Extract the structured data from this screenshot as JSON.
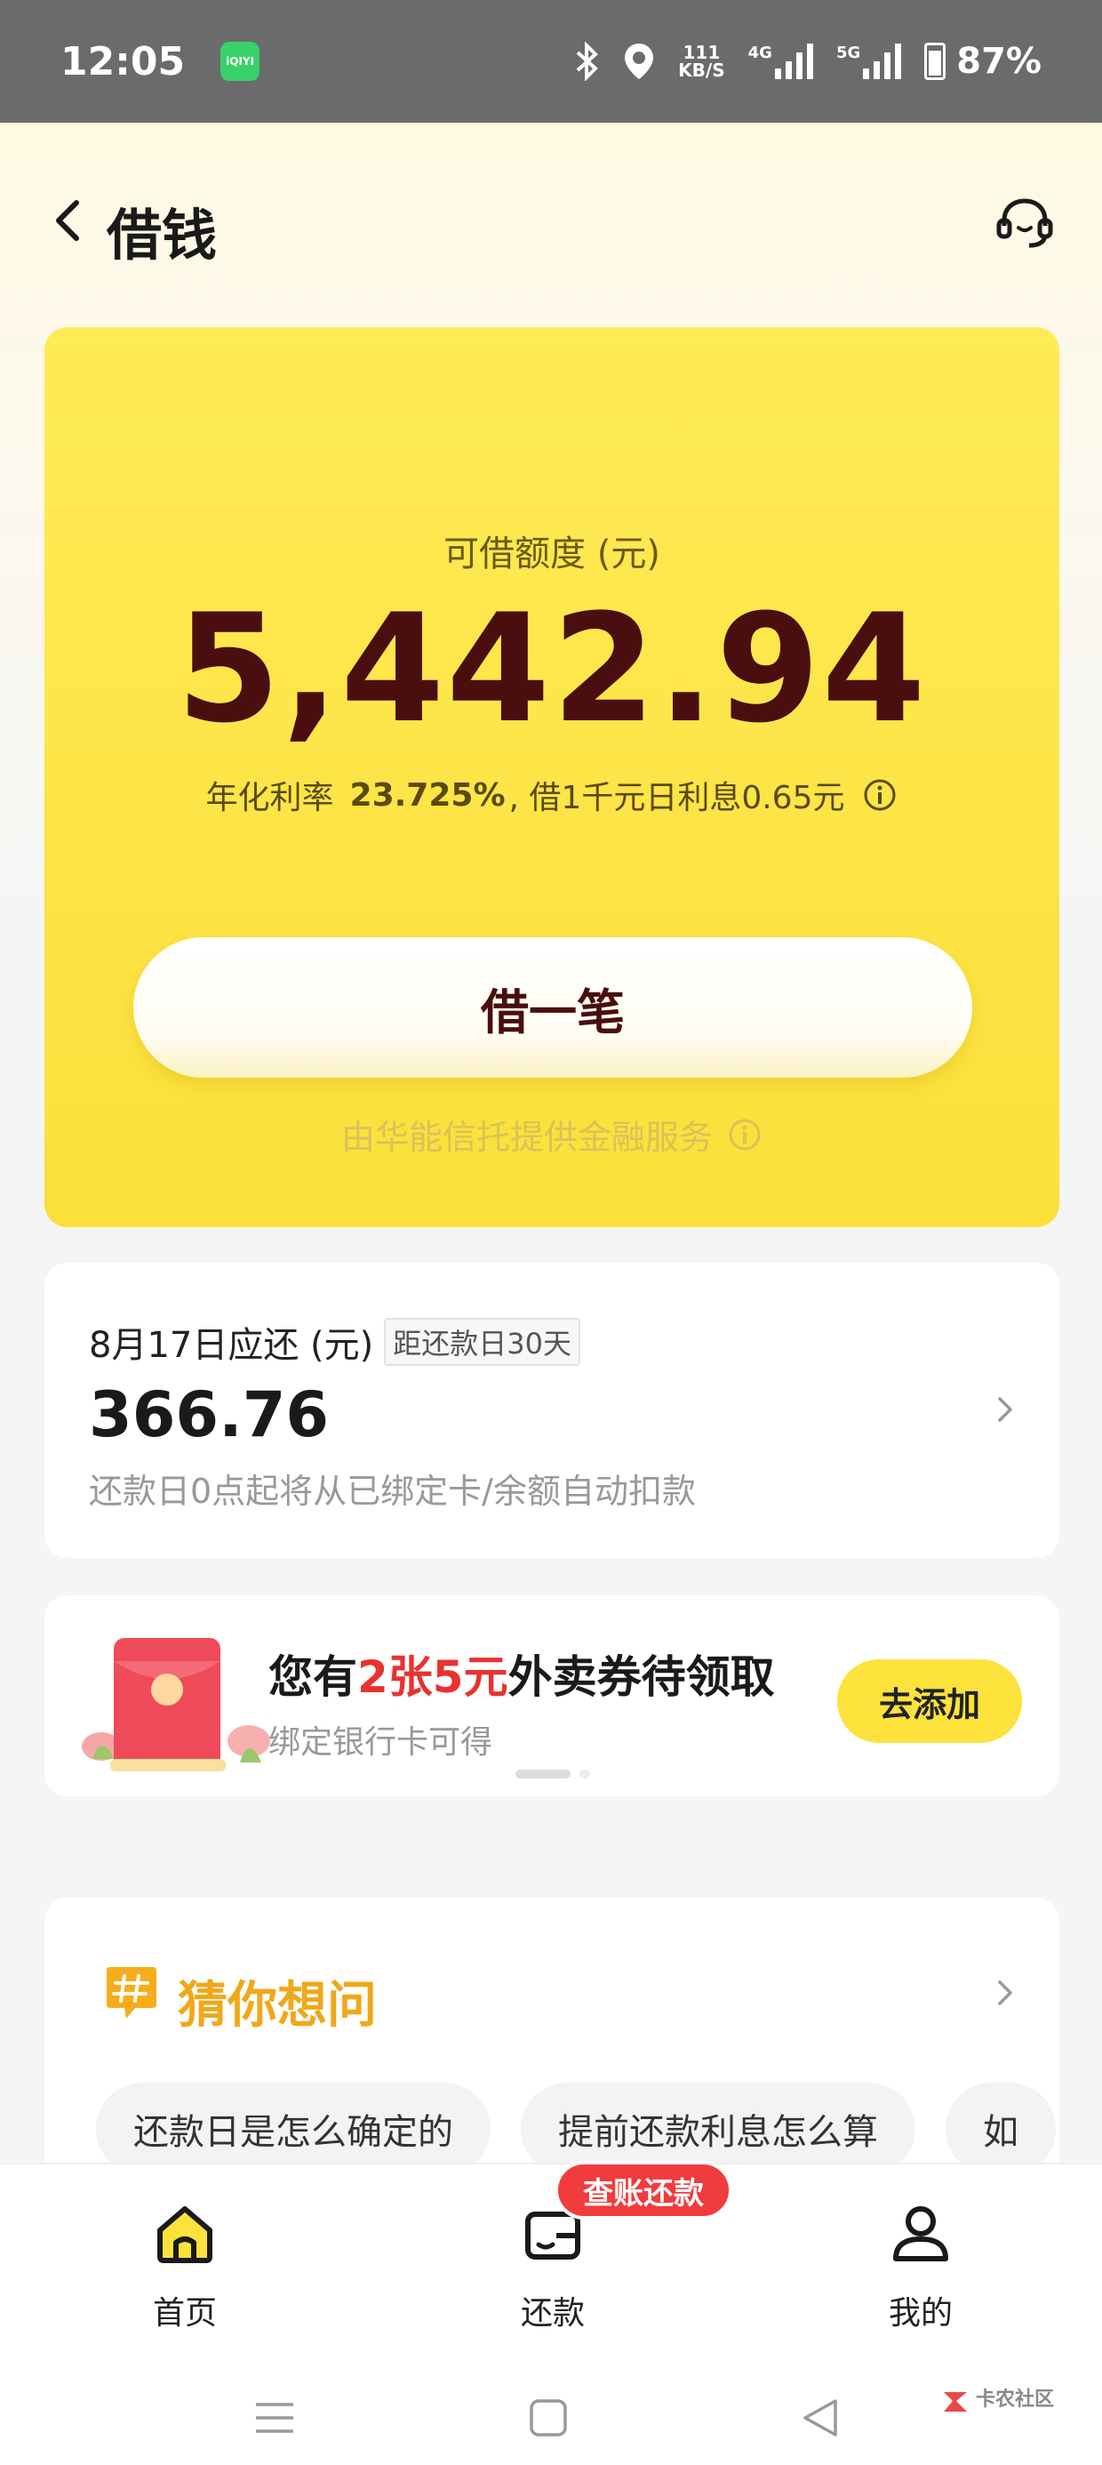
{
  "status_bar": {
    "time": "12:05",
    "app_badge": "iQIYI",
    "speed_value": "111",
    "speed_unit": "KB/S",
    "net1": "4G",
    "net2": "5G",
    "battery": "87%"
  },
  "header": {
    "title": "借钱"
  },
  "credit": {
    "label": "可借额度 (元)",
    "amount": "5,442.94",
    "rate_prefix": "年化利率",
    "rate_value": "23.725%",
    "rate_suffix": ", 借1千元日利息0.65元",
    "borrow_button": "借一笔",
    "provider": "由华能信托提供金融服务"
  },
  "repayment": {
    "title": "8月17日应还 (元)",
    "days_badge": "距还款日30天",
    "amount": "366.76",
    "note": "还款日0点起将从已绑定卡/余额自动扣款"
  },
  "promo": {
    "title_a": "您有",
    "title_highlight": "2张5元",
    "title_b": "外卖券待领取",
    "subtitle": "绑定银行卡可得",
    "button": "去添加"
  },
  "faq": {
    "title": "猜你想问",
    "chips": [
      "还款日是怎么确定的",
      "提前还款利息怎么算",
      "如"
    ]
  },
  "bottom_nav": {
    "home": "首页",
    "repay": "还款",
    "mine": "我的",
    "badge": "查账还款"
  },
  "watermark": {
    "text": "卡农社区"
  },
  "colors": {
    "accent_yellow": "#fde23c",
    "amount_brown": "#4a0e0e",
    "highlight_red": "#e8322f",
    "faq_orange": "#f0a81a"
  }
}
